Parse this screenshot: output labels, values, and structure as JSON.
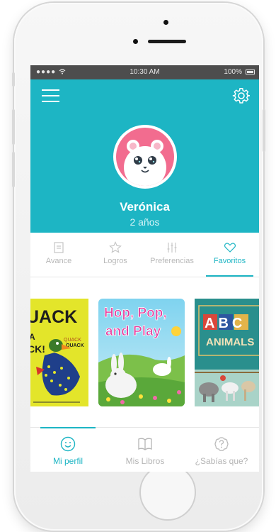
{
  "status_bar": {
    "signal": "●●●● ",
    "time": "10:30 AM",
    "battery": "100%"
  },
  "profile": {
    "name": "Verónica",
    "age": "2 años"
  },
  "tabs": [
    {
      "label": "Avance",
      "icon": "chart-icon"
    },
    {
      "label": "Logros",
      "icon": "star-icon"
    },
    {
      "label": "Preferencias",
      "icon": "sliders-icon"
    },
    {
      "label": "Favoritos",
      "icon": "heart-icon",
      "active": true
    }
  ],
  "books": [
    {
      "title": "UACK",
      "subtitle_a": "A",
      "subtitle_b": "CK!",
      "quack_text": "QUACK"
    },
    {
      "title_line1": "Hop, Pop,",
      "title_line2": "and Play"
    },
    {
      "title_line1": "ABC",
      "title_line2": "ANIMALS"
    }
  ],
  "bottom_nav": [
    {
      "label": "Mi perfil",
      "icon": "smile-icon",
      "active": true
    },
    {
      "label": "Mis Libros",
      "icon": "book-icon"
    },
    {
      "label": "¿Sabías que?",
      "icon": "question-icon"
    }
  ],
  "colors": {
    "accent": "#1db5c4",
    "avatar_bg": "#f26c8f",
    "status_bar": "#4d4d4d"
  }
}
